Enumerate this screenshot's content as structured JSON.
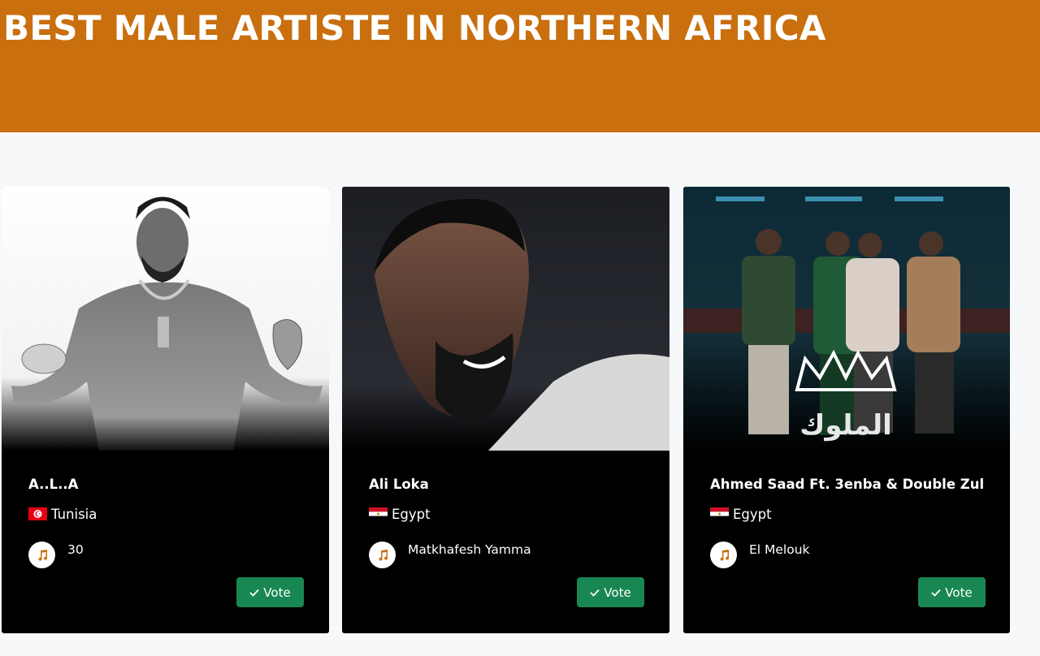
{
  "page": {
    "title": "BEST MALE ARTISTE IN NORTHERN AFRICA",
    "banner_color": "#c96f0e"
  },
  "nominees": [
    {
      "name": "A..L..A",
      "country": "Tunisia",
      "flag": "tunisia-flag-icon",
      "song": "30",
      "vote_label": "Vote"
    },
    {
      "name": "Ali Loka",
      "country": "Egypt",
      "flag": "egypt-flag-icon",
      "song": "Matkhafesh Yamma",
      "vote_label": "Vote"
    },
    {
      "name": "Ahmed Saad Ft. 3enba & Double Zul",
      "country": "Egypt",
      "flag": "egypt-flag-icon",
      "song": "El Melouk",
      "vote_label": "Vote",
      "artwork_text": "الملوك"
    }
  ],
  "colors": {
    "card_bg": "#000000",
    "vote_button": "#198754",
    "music_icon": "#c96f0e"
  }
}
